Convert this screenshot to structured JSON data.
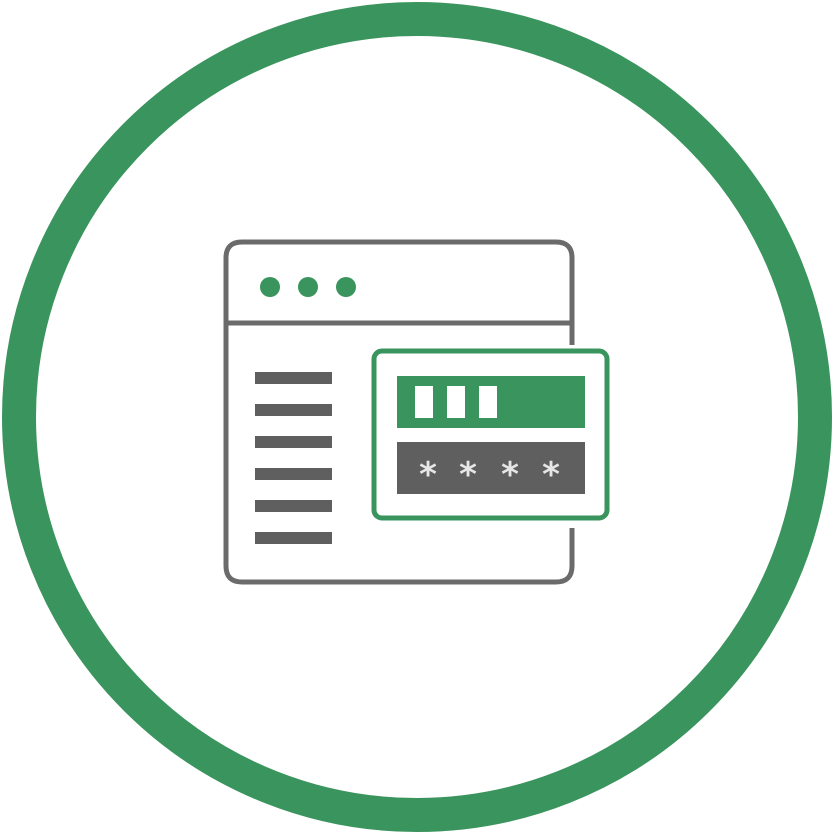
{
  "icon": {
    "name": "secure-login-window-icon",
    "masked_chars": [
      "*",
      "*",
      "*",
      "*"
    ]
  },
  "colors": {
    "accent_green": "#3a945d",
    "stroke_gray": "#6b6b6b",
    "bar_gray": "#5f5f5f",
    "background": "#ffffff"
  }
}
